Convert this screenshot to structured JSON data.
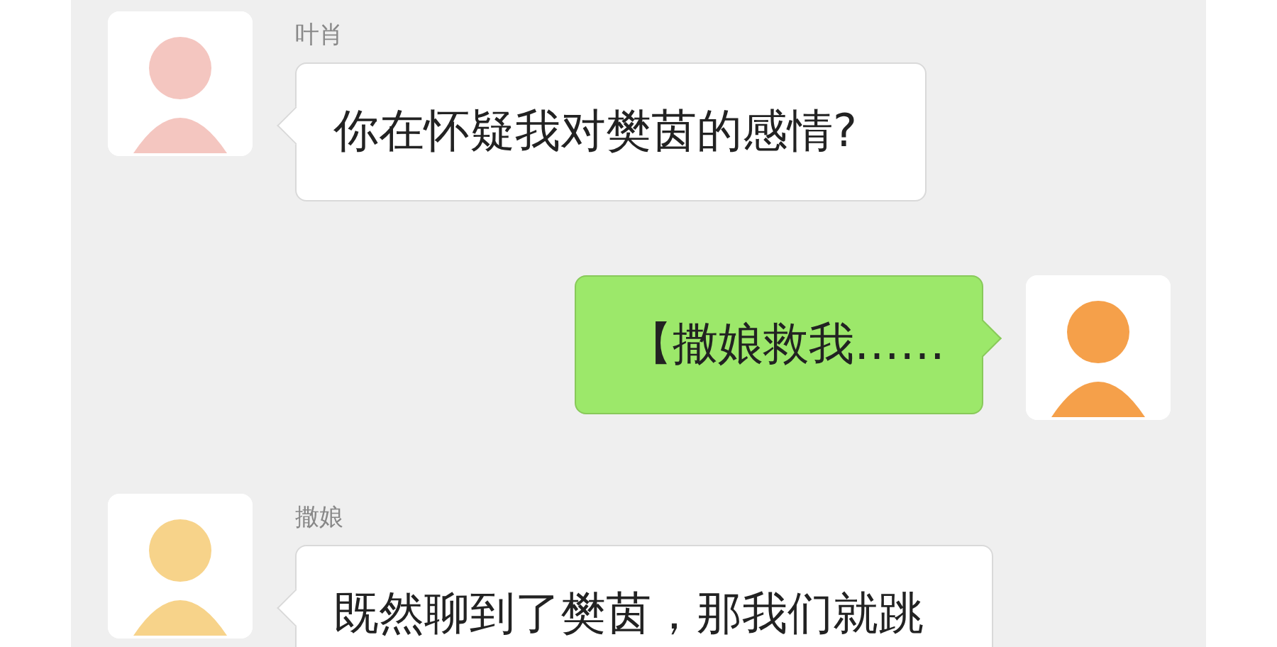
{
  "messages": [
    {
      "kind": "received",
      "sender": "叶肖",
      "text": "你在怀疑我对樊茵的感情?"
    },
    {
      "kind": "sent",
      "text": "【撒娘救我……"
    },
    {
      "kind": "received",
      "sender": "撒娘",
      "text": "既然聊到了樊茵，那我们就跳"
    }
  ]
}
